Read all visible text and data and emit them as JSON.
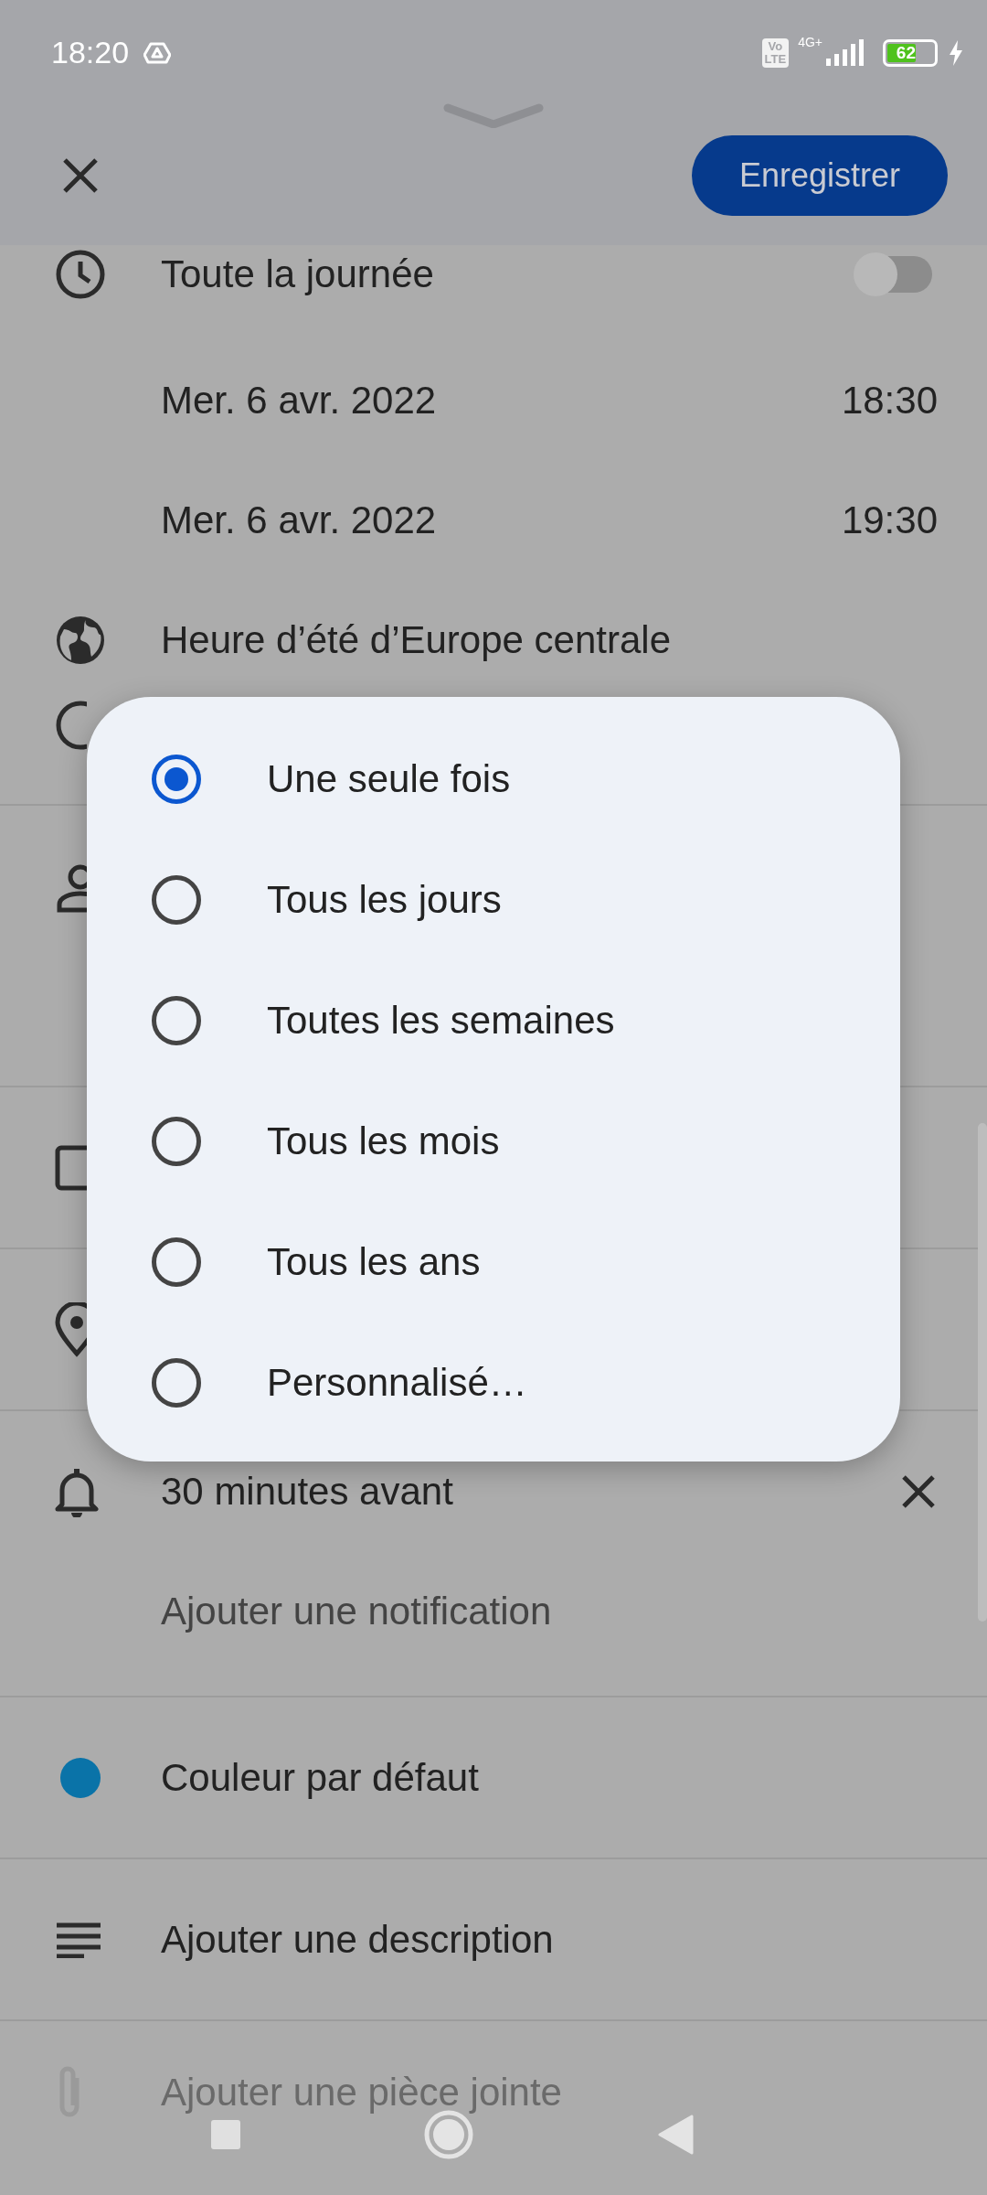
{
  "status_bar": {
    "time": "18:20",
    "volte_top": "Vo",
    "volte_bottom": "LTE",
    "network": "4G+",
    "battery": "62"
  },
  "header": {
    "save_button": "Enregistrer"
  },
  "all_day": {
    "label": "Toute la journée",
    "on": false
  },
  "dates": [
    {
      "date": "Mer. 6 avr. 2022",
      "time": "18:30"
    },
    {
      "date": "Mer. 6 avr. 2022",
      "time": "19:30"
    }
  ],
  "timezone": "Heure d’été d’Europe centrale",
  "notification": {
    "label": "30 minutes avant",
    "add": "Ajouter une notification"
  },
  "color": {
    "label": "Couleur par défaut"
  },
  "description": "Ajouter une description",
  "attachment": "Ajouter une pièce jointe",
  "repeat_dialog": {
    "options": [
      {
        "label": "Une seule fois",
        "selected": true
      },
      {
        "label": "Tous les jours",
        "selected": false
      },
      {
        "label": "Toutes les semaines",
        "selected": false
      },
      {
        "label": "Tous les mois",
        "selected": false
      },
      {
        "label": "Tous les ans",
        "selected": false
      },
      {
        "label": "Personnalisé…",
        "selected": false
      }
    ]
  }
}
